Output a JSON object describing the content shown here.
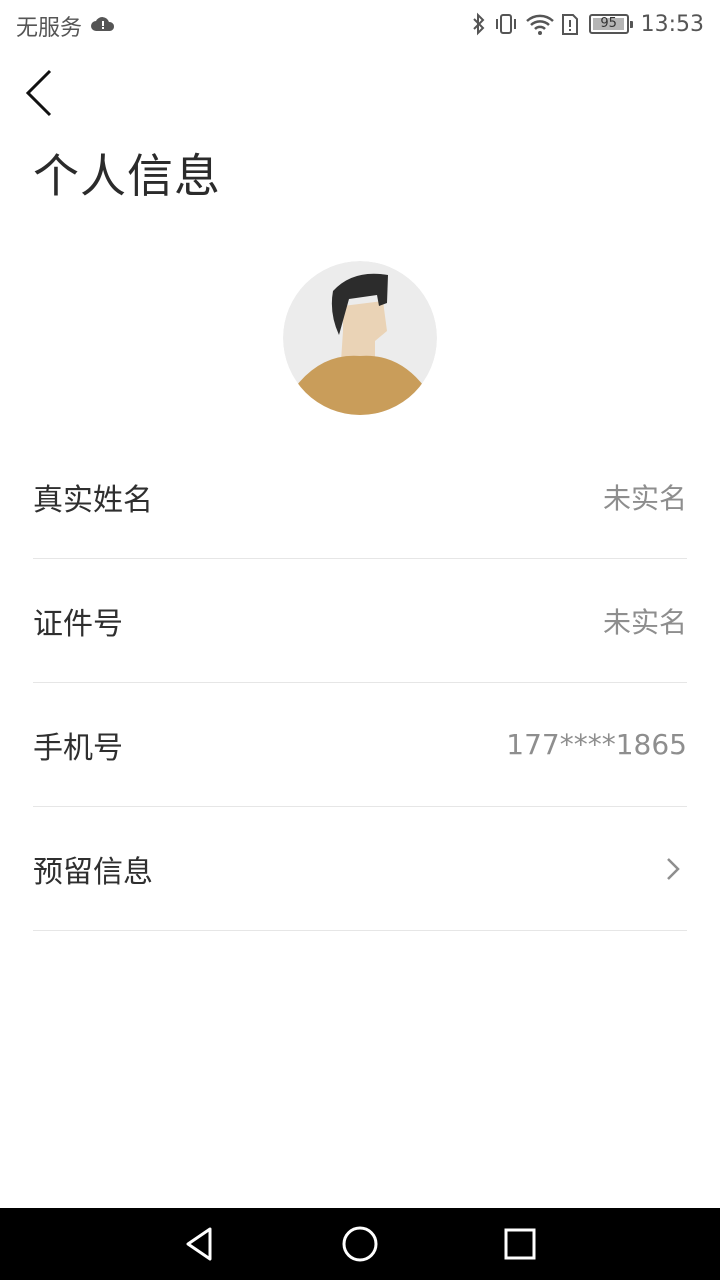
{
  "status_bar": {
    "carrier": "无服务",
    "battery": "95",
    "time": "13:53"
  },
  "header": {
    "title": "个人信息"
  },
  "profile": {
    "rows": [
      {
        "label": "真实姓名",
        "value": "未实名"
      },
      {
        "label": "证件号",
        "value": "未实名"
      },
      {
        "label": "手机号",
        "value": "177****1865"
      },
      {
        "label": "预留信息",
        "value": ""
      }
    ]
  },
  "colors": {
    "avatar_bg": "#ececec",
    "shirt": "#c99d5a",
    "skin": "#ead3b6",
    "hair": "#2c2c2c"
  },
  "icons": {
    "back": "chevron-left-icon",
    "row_arrow": "chevron-right-icon",
    "nav": [
      "back-triangle-icon",
      "home-circle-icon",
      "recents-square-icon"
    ]
  }
}
